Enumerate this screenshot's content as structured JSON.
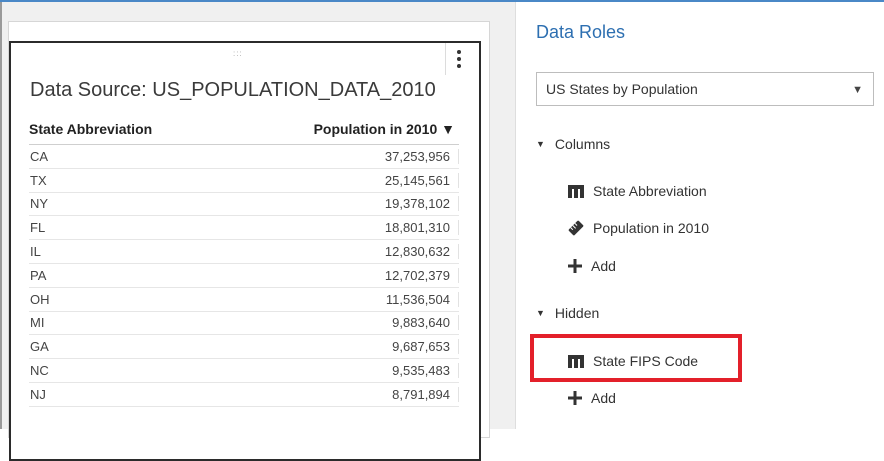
{
  "report": {
    "title": "Data Source: US_POPULATION_DATA_2010",
    "columns": [
      "State Abbreviation",
      "Population in 2010 ▼"
    ],
    "rows": [
      [
        "CA",
        "37,253,956"
      ],
      [
        "TX",
        "25,145,561"
      ],
      [
        "NY",
        "19,378,102"
      ],
      [
        "FL",
        "18,801,310"
      ],
      [
        "IL",
        "12,830,632"
      ],
      [
        "PA",
        "12,702,379"
      ],
      [
        "OH",
        "11,536,504"
      ],
      [
        "MI",
        "9,883,640"
      ],
      [
        "GA",
        "9,687,653"
      ],
      [
        "NC",
        "9,535,483"
      ],
      [
        "NJ",
        "8,791,894"
      ]
    ]
  },
  "data_roles": {
    "title": "Data Roles",
    "selected_source": "US States by Population",
    "columns_label": "Columns",
    "columns_items": [
      "State Abbreviation",
      "Population in 2010"
    ],
    "add_label": "Add",
    "hidden_label": "Hidden",
    "hidden_items": [
      "State FIPS Code"
    ]
  },
  "colors": {
    "accent": "#2d6fb1",
    "highlight": "#e3202a",
    "top_line": "#4a88c7"
  },
  "icons": [
    "category-icon",
    "measure-icon",
    "plus-icon",
    "kebab-menu-icon",
    "dropdown-caret-icon"
  ]
}
